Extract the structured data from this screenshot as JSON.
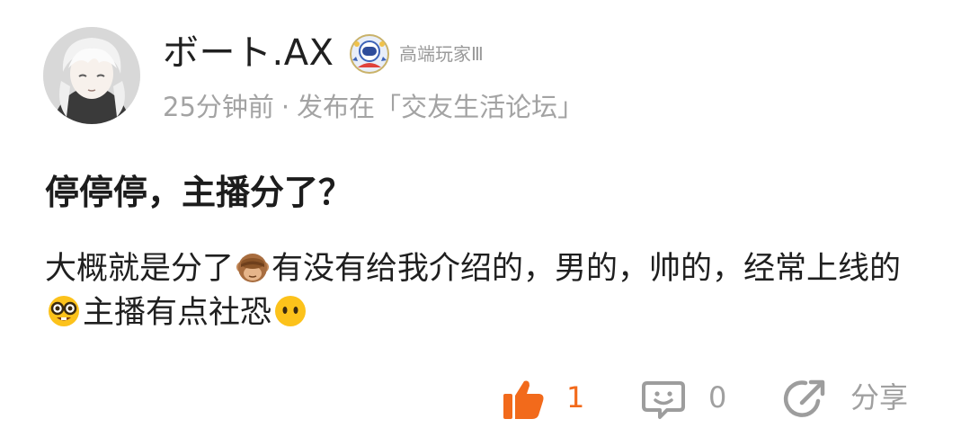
{
  "post": {
    "author": {
      "name": "ボート.AX",
      "level": "高端玩家Ⅲ",
      "avatar_icon": "anime-avatar-icon",
      "badge_icon": "astronaut-badge-icon"
    },
    "meta": {
      "time": "25分钟前",
      "separator": "·",
      "published_in": "发布在「交友生活论坛」"
    },
    "title": "停停停，主播分了？",
    "body": {
      "part1": "大概就是分了",
      "part2": "有没有给我介绍的，男的，帅的，经常上线的",
      "part3": "主播有点社恐",
      "emojis": [
        "see-no-evil-monkey-emoji",
        "nerd-face-emoji",
        "face-without-mouth-emoji"
      ]
    },
    "actions": {
      "like_count": "1",
      "comment_count": "0",
      "share_label": "分享",
      "like_icon": "thumbs-up-icon",
      "comment_icon": "comment-icon",
      "share_icon": "share-icon"
    },
    "colors": {
      "accent": "#f26a1b",
      "muted": "#a3a3a3",
      "text": "#1f1f1f"
    }
  }
}
